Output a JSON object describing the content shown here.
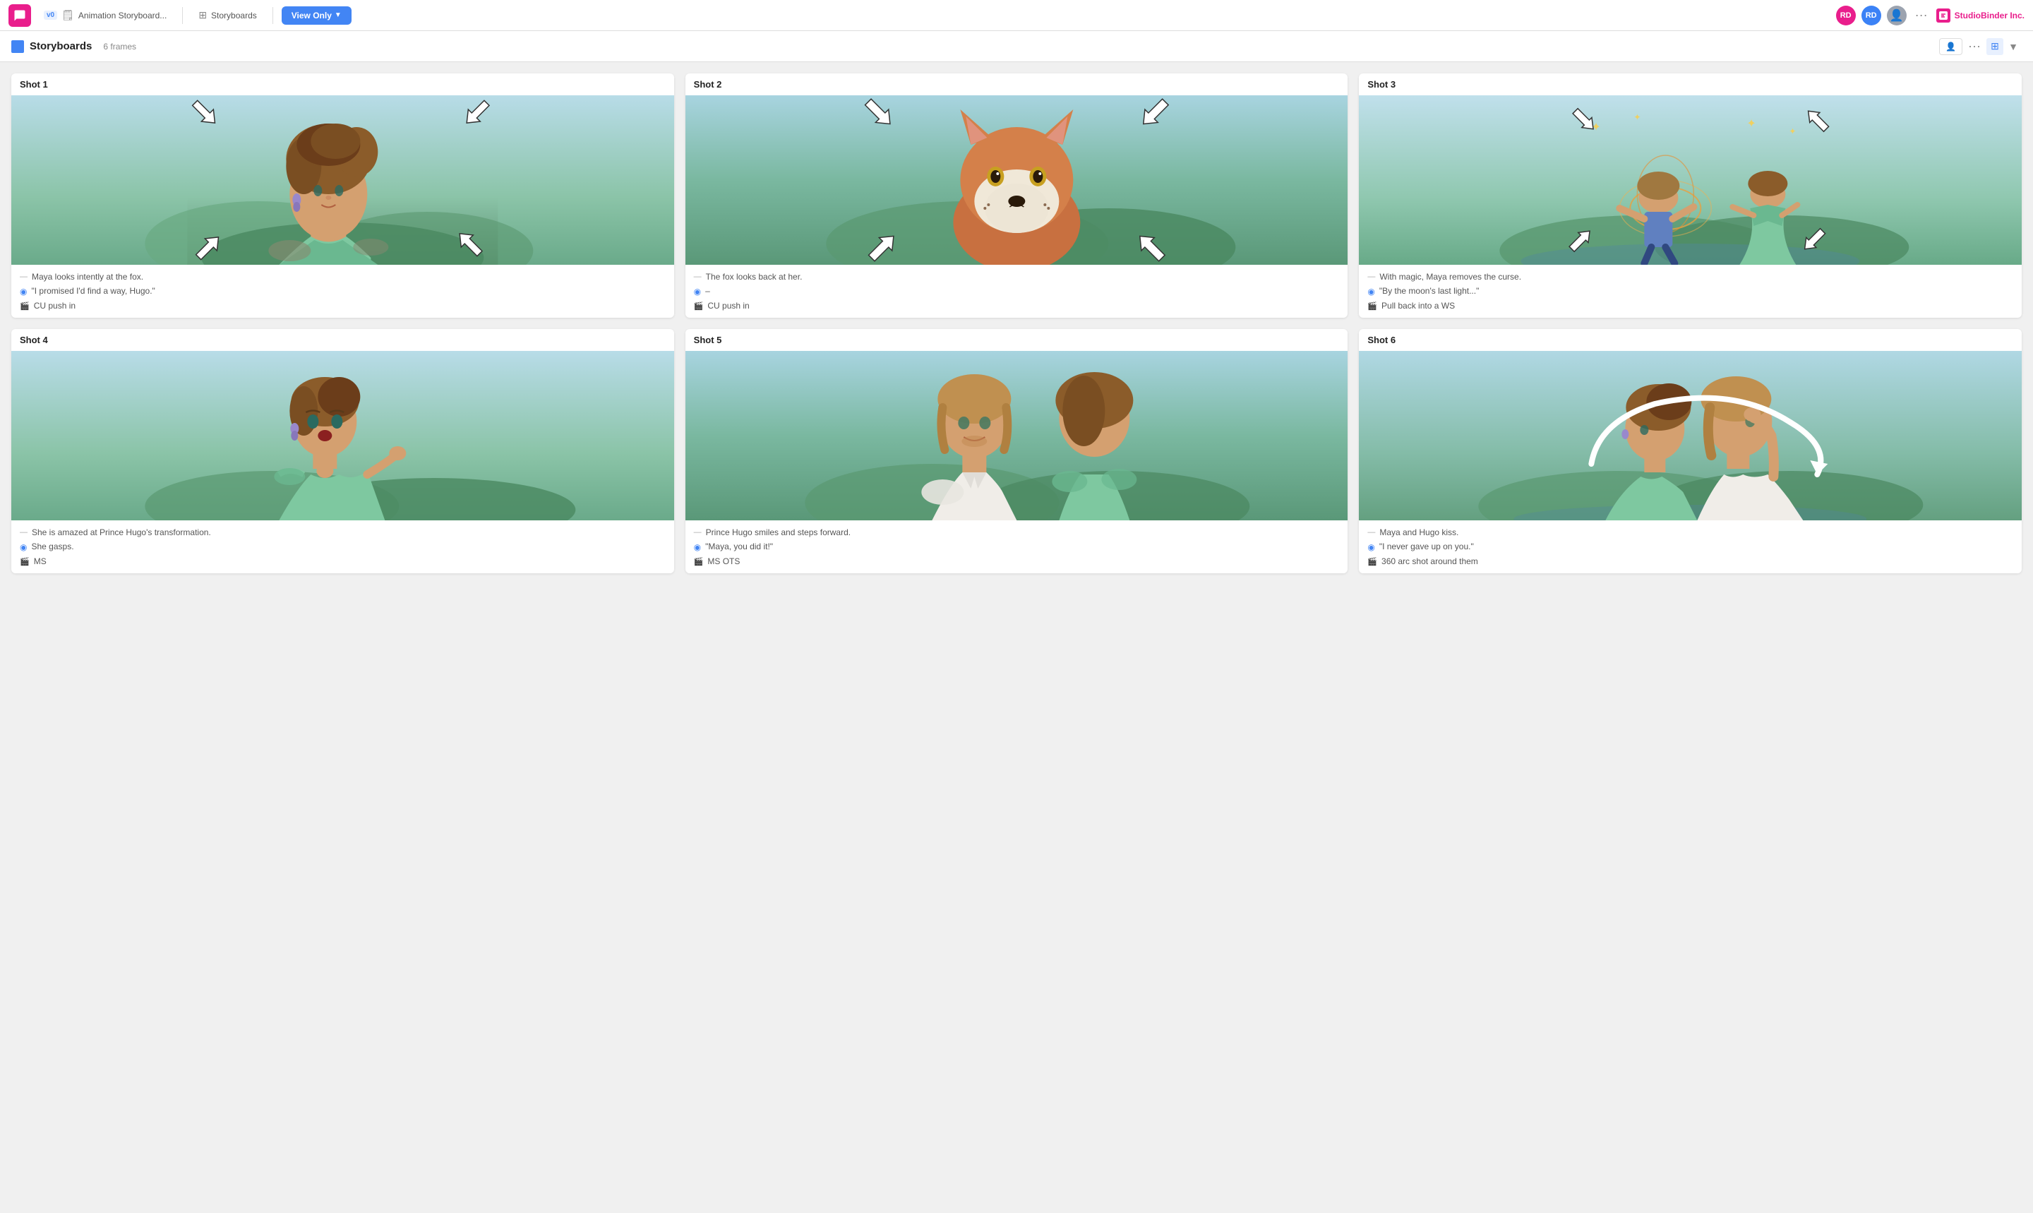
{
  "nav": {
    "version": "v0",
    "project": "Animation Storyboard...",
    "section": "Storyboards",
    "view_only": "View Only",
    "studio": "StudioBinder Inc.",
    "avatar1": "RD",
    "avatar1_color": "#e91e8c",
    "avatar2": "RD",
    "avatar2_color": "#3b82f6"
  },
  "subnav": {
    "title": "Storyboards",
    "frames": "6 frames"
  },
  "shots": [
    {
      "number": "Shot  1",
      "description": "Maya looks intently at the fox.",
      "dialog": "\"I promised I'd find a way, Hugo.\"",
      "camera": "CU push in"
    },
    {
      "number": "Shot  2",
      "description": "The fox looks back at her.",
      "dialog": "–",
      "camera": "CU push in"
    },
    {
      "number": "Shot  3",
      "description": "With magic, Maya removes the curse.",
      "dialog": "\"By the moon's last light...\"",
      "camera": "Pull back into a WS"
    },
    {
      "number": "Shot  4",
      "description": "She is amazed at Prince Hugo's transformation.",
      "dialog": "She gasps.",
      "camera": "MS"
    },
    {
      "number": "Shot  5",
      "description": "Prince Hugo smiles and steps forward.",
      "dialog": "\"Maya, you did it!\"",
      "camera": "MS OTS"
    },
    {
      "number": "Shot  6",
      "description": "Maya and Hugo kiss.",
      "dialog": "\"I never gave up on you.\"",
      "camera": "360 arc shot around them"
    }
  ]
}
